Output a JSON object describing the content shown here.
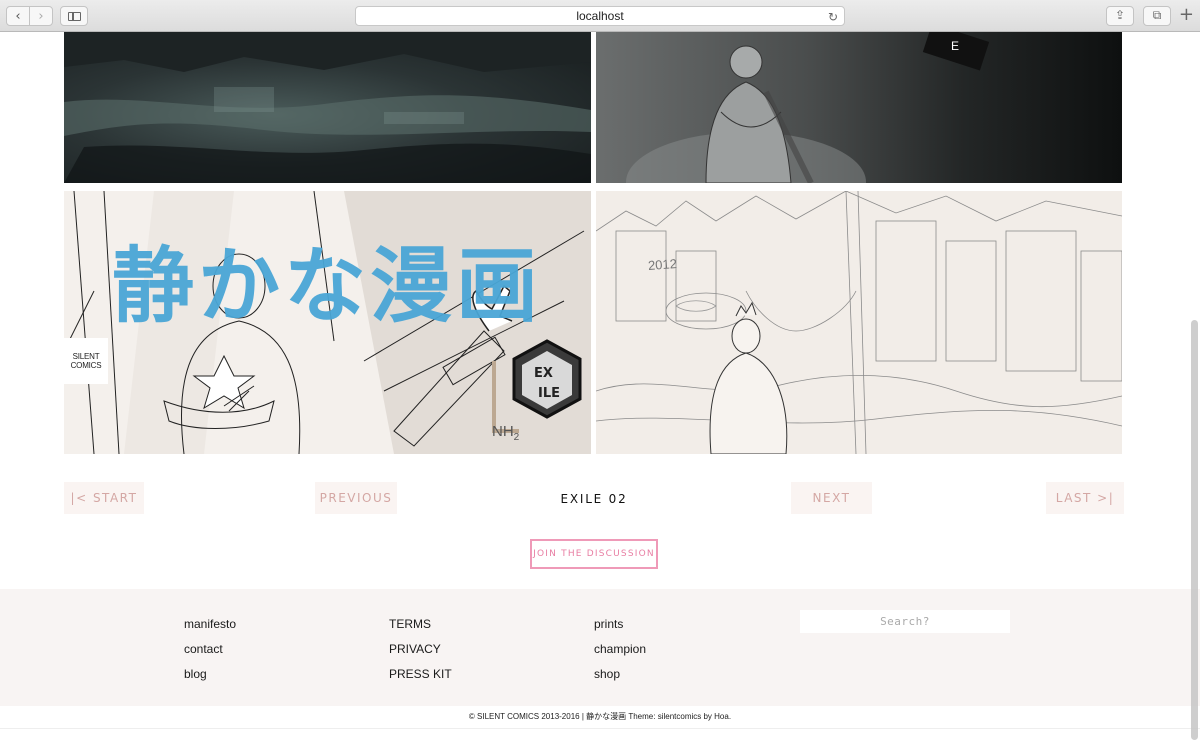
{
  "browser": {
    "url": "localhost",
    "back_glyph": "‹",
    "forward_glyph": "›",
    "reload_glyph": "↻",
    "share_glyph": "⇪",
    "tabs_glyph": "⧉",
    "new_tab_glyph": "+"
  },
  "comic": {
    "panel3": {
      "title_jp": "静かな漫画",
      "logo_line1": "SILENT",
      "logo_line2": "COMICS",
      "label_nh2": "NH",
      "label_nh2_sub": "2",
      "badge_text": "EX ILE"
    },
    "panel4": {
      "year_text": "2012"
    }
  },
  "pager": {
    "start_label": "|< START",
    "prev_label": "PREVIOUS",
    "current_label": "EXILE 02",
    "next_label": "NEXT",
    "last_label": "LAST >|"
  },
  "discuss_label": "JOIN THE DISCUSSION",
  "footer": {
    "col1": [
      "manifesto",
      "contact",
      "blog"
    ],
    "col2": [
      "TERMS",
      "PRIVACY",
      "PRESS KIT"
    ],
    "col3": [
      "prints",
      "champion",
      "shop"
    ],
    "search_placeholder": "Search?",
    "copyright": "© SILENT COMICS 2013-2016 | 静かな漫画 Theme: silentcomics by Hoa."
  },
  "colors": {
    "accent_pink": "#e87ea3",
    "title_blue": "#4aa6d6",
    "pager_text": "#d4a7a4",
    "footer_bg": "#f8f4f3"
  }
}
